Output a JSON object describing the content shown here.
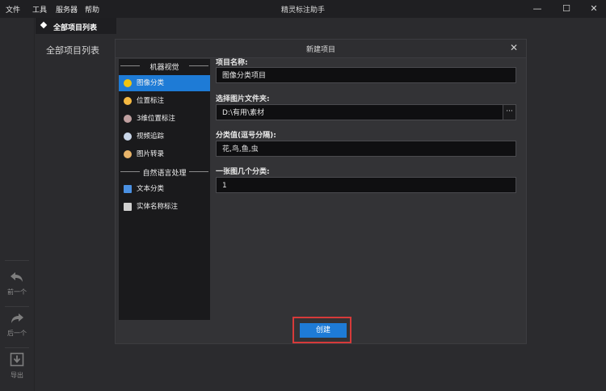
{
  "menu": [
    "文件",
    "工具",
    "服务器",
    "帮助"
  ],
  "app_title": "精灵标注助手",
  "window_controls": {
    "minimize": "—",
    "maximize": "☐",
    "close": "✕"
  },
  "tab": {
    "label": "全部项目列表"
  },
  "list_label": "全部项目列表",
  "rail": [
    {
      "icon": "undo-arrow-icon",
      "label": "前一个"
    },
    {
      "icon": "redo-arrow-icon",
      "label": "后一个"
    },
    {
      "icon": "export-icon",
      "label": "导出"
    }
  ],
  "dialog": {
    "title": "新建项目",
    "close_glyph": "✕",
    "sections": [
      {
        "header": "机器视觉",
        "items": [
          {
            "label": "图像分类",
            "icon": "image-classify-icon",
            "color": "#f1c40f",
            "active": true
          },
          {
            "label": "位置标注",
            "icon": "position-label-icon",
            "color": "#f5b942",
            "active": false
          },
          {
            "label": "3维位置标注",
            "icon": "3d-label-icon",
            "color": "#c0a0a0",
            "active": false
          },
          {
            "label": "视频追踪",
            "icon": "video-track-icon",
            "color": "#c9d6e8",
            "active": false
          },
          {
            "label": "图片转录",
            "icon": "image-transcribe-icon",
            "color": "#e8b46a",
            "active": false
          }
        ]
      },
      {
        "header": "自然语言处理",
        "items": [
          {
            "label": "文本分类",
            "icon": "text-classify-icon",
            "color": "#4a90e2",
            "active": false
          },
          {
            "label": "实体名称标注",
            "icon": "entity-label-icon",
            "color": "#d0d0d0",
            "active": false
          }
        ]
      }
    ],
    "fields": {
      "project_name_label": "项目名称:",
      "project_name_value": "图像分类项目",
      "folder_label": "选择图片文件夹:",
      "folder_value": "D:\\有用\\素材",
      "browse_label": "···",
      "categories_label": "分类值(逗号分隔):",
      "categories_value": "花,鸟,鱼,虫",
      "per_image_label": "一张图几个分类:",
      "per_image_value": "1"
    },
    "create_button": "创建"
  }
}
